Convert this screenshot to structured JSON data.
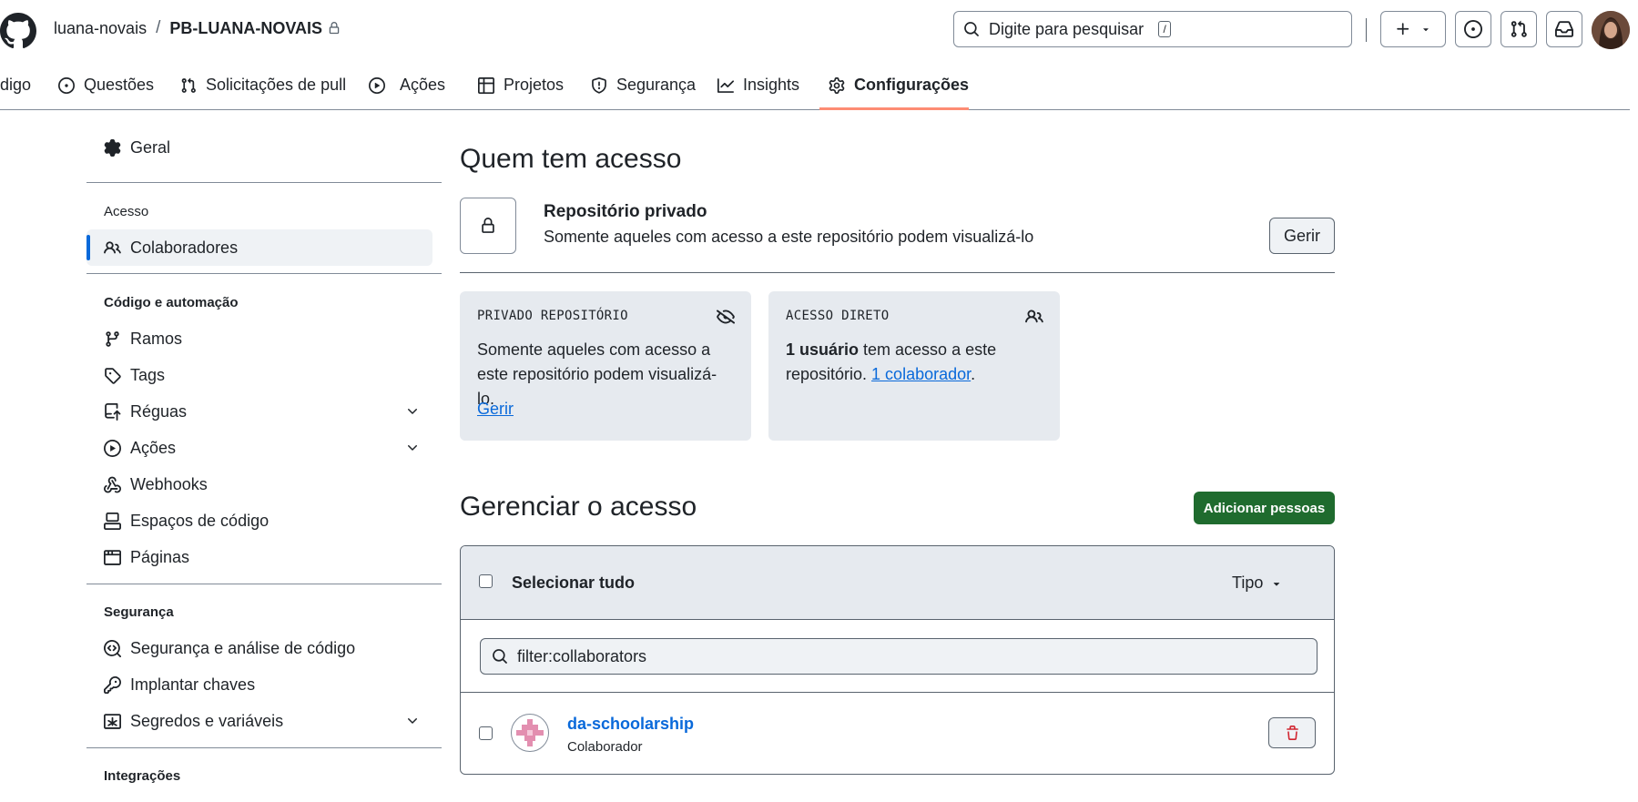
{
  "header": {
    "owner": "luana-novais",
    "separator": "/",
    "repo": "PB-LUANA-NOVAIS",
    "search_placeholder": "Digite para pesquisar",
    "search_shortcut": "/"
  },
  "tabs": [
    {
      "label": "digo"
    },
    {
      "label": "Questões"
    },
    {
      "label": "Solicitações de pull"
    },
    {
      "label": "Ações"
    },
    {
      "label": "Projetos"
    },
    {
      "label": "Segurança"
    },
    {
      "label": "Insights"
    },
    {
      "label": "Configurações",
      "active": true
    }
  ],
  "sidebar": {
    "general": "Geral",
    "access_heading": "Acesso",
    "collaborators": "Colaboradores",
    "code_heading": "Código e automação",
    "branches": "Ramos",
    "tags": "Tags",
    "rules": "Réguas",
    "actions": "Ações",
    "webhooks": "Webhooks",
    "codespaces": "Espaços de código",
    "pages": "Páginas",
    "security_heading": "Segurança",
    "code_security": "Segurança e análise de código",
    "deploy_keys": "Implantar chaves",
    "secrets": "Segredos e variáveis",
    "integrations_heading": "Integrações"
  },
  "access": {
    "title": "Quem tem acesso",
    "repo_visibility": "Repositório privado",
    "repo_visibility_desc": "Somente aqueles com acesso a este repositório podem visualizá-lo",
    "manage_button": "Gerir",
    "card_private": {
      "title": "PRIVADO REPOSITÓRIO",
      "text": "Somente aqueles com acesso a este repositório podem visualizá-lo.",
      "link": "Gerir"
    },
    "card_direct": {
      "title": "ACESSO DIRETO",
      "users_bold": "1 usuário",
      "text_mid": " tem acesso a este repositório. ",
      "link": "1 colaborador",
      "text_end": "."
    }
  },
  "manage": {
    "title": "Gerenciar o acesso",
    "add_button": "Adicionar pessoas",
    "select_all": "Selecionar tudo",
    "type_filter": "Tipo",
    "filter_value": "filter:collaborators",
    "members": [
      {
        "name": "da-schoolarship",
        "role": "Colaborador"
      }
    ]
  },
  "colors": {
    "accent": "#0969da",
    "primary_button": "#1f6b2e",
    "tab_underline": "#fd8c73",
    "danger": "#d1242f"
  }
}
